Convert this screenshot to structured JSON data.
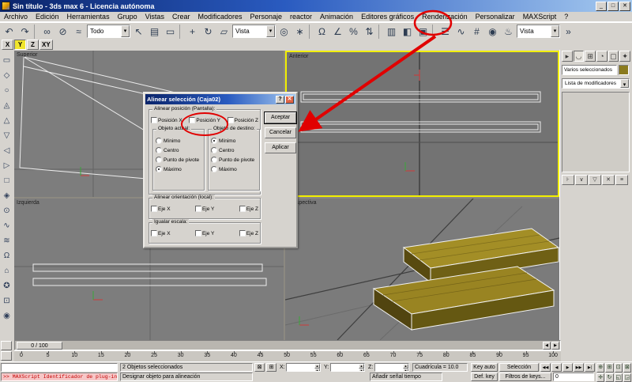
{
  "window": {
    "title": "Sin título - 3ds max 6 - Licencia autónoma"
  },
  "window_buttons": {
    "minimize": "_",
    "maximize": "□",
    "close": "✕"
  },
  "icons": {
    "dropdown_arrow": "▾",
    "spinner_up": "▴",
    "spinner_down": "▾",
    "lock": "⊠",
    "absolute": "⊞"
  },
  "menu": {
    "items": [
      "Archivo",
      "Edición",
      "Herramientas",
      "Grupo",
      "Vistas",
      "Crear",
      "Modificadores",
      "Personaje",
      "reactor",
      "Animación",
      "Editores gráficos",
      "Renderización",
      "Personalizar",
      "MAXScript",
      "?"
    ]
  },
  "toolbar": {
    "filter_value": "Todo",
    "coord_value": "Vista",
    "render_value": "Vista",
    "icons": {
      "undo": "↶",
      "redo": "↷",
      "link": "∞",
      "unlink": "⊘",
      "bind": "≈",
      "select": "↖",
      "select_by_name": "▤",
      "region": "▭",
      "move": "+",
      "rotate": "↻",
      "scale": "▱",
      "pivot": "◎",
      "manipulate": "∗",
      "snap": "Ω",
      "angle_snap": "∠",
      "percent_snap": "%",
      "spinner_snap": "⇅",
      "named_sel": "▥",
      "mirror": "◧",
      "align": "▣",
      "layers": "☰",
      "curve_editor": "∿",
      "schematic": "#",
      "material": "◉",
      "render": "♨",
      "quick_render": "»"
    }
  },
  "axis_toolbar": {
    "items": [
      {
        "label": "X",
        "active": false
      },
      {
        "label": "Y",
        "active": true
      },
      {
        "label": "Z",
        "active": false
      },
      {
        "label": "XY",
        "active": false
      }
    ]
  },
  "left_toolbar": {
    "icons": [
      {
        "n": "left-toolbar-icon",
        "g": "▭"
      },
      {
        "n": "left-toolbar-icon",
        "g": "◇"
      },
      {
        "n": "left-toolbar-icon",
        "g": "○"
      },
      {
        "n": "left-toolbar-icon",
        "g": "◬"
      },
      {
        "n": "left-toolbar-icon",
        "g": "△"
      },
      {
        "n": "left-toolbar-icon",
        "g": "▽"
      },
      {
        "n": "left-toolbar-icon",
        "g": "◁"
      },
      {
        "n": "left-toolbar-icon",
        "g": "▷"
      },
      {
        "n": "left-toolbar-icon",
        "g": "□"
      },
      {
        "n": "left-toolbar-icon",
        "g": "◈"
      },
      {
        "n": "left-toolbar-icon",
        "g": "⊙"
      },
      {
        "n": "left-toolbar-icon",
        "g": "∿"
      },
      {
        "n": "left-toolbar-icon",
        "g": "≋"
      },
      {
        "n": "left-toolbar-icon",
        "g": "Ω"
      },
      {
        "n": "left-toolbar-icon",
        "g": "⌂"
      },
      {
        "n": "left-toolbar-icon",
        "g": "✪"
      },
      {
        "n": "left-toolbar-icon",
        "g": "⊡"
      },
      {
        "n": "left-toolbar-icon",
        "g": "◉"
      }
    ]
  },
  "viewports": {
    "top_left_label": "Superior",
    "top_right_label": "Anterior",
    "bottom_left_label": "Izquierda",
    "bottom_right_label": "Perspectiva"
  },
  "dialog": {
    "title": "Alinear selección (Caja02)",
    "help_button": "?",
    "close_button": "✕",
    "position_group": "Alinear posición (Pantalla):",
    "position_checks": [
      "Posición X",
      "Posición Y",
      "Posición Z"
    ],
    "current_group": "Objeto actual:",
    "target_group": "Objeto de destino:",
    "current_options": [
      {
        "label": "Mínimo",
        "checked": false
      },
      {
        "label": "Centro",
        "checked": false
      },
      {
        "label": "Punto de pivote",
        "checked": false
      },
      {
        "label": "Máximo",
        "checked": true
      }
    ],
    "target_options": [
      {
        "label": "Mínimo",
        "checked": true
      },
      {
        "label": "Centro",
        "checked": false
      },
      {
        "label": "Punto de pivote",
        "checked": false
      },
      {
        "label": "Máximo",
        "checked": false
      }
    ],
    "orientation_group": "Alinear orientación (local):",
    "scale_group": "Igualar escala:",
    "axis_checks": [
      "Eje X",
      "Eje Y",
      "Eje Z"
    ],
    "buttons": {
      "ok": "Aceptar",
      "cancel": "Cancelar",
      "apply": "Aplicar"
    }
  },
  "command_panel": {
    "tabs": [
      {
        "n": "tab-create",
        "g": "▸",
        "active": false
      },
      {
        "n": "tab-modify",
        "g": "◡",
        "active": true
      },
      {
        "n": "tab-hierarchy",
        "g": "⊞",
        "active": false
      },
      {
        "n": "tab-motion",
        "g": "◔",
        "active": false
      },
      {
        "n": "tab-display",
        "g": "▢",
        "active": false
      },
      {
        "n": "tab-utilities",
        "g": "✦",
        "active": false
      }
    ],
    "name_field": "Varios seleccionados",
    "modifier_list": "Lista de modificadores",
    "object_color": "#8a7a1e",
    "stack_buttons": [
      {
        "n": "pin-stack-icon",
        "g": "⊦"
      },
      {
        "n": "show-end-result-icon",
        "g": "∨"
      },
      {
        "n": "make-unique-icon",
        "g": "▽"
      },
      {
        "n": "remove-modifier-icon",
        "g": "✕"
      },
      {
        "n": "configure-stack-icon",
        "g": "≡"
      }
    ]
  },
  "timeline": {
    "slider": "0 / 100",
    "left_arrow": "◀",
    "right_arrow": "▶",
    "ticks": [
      0,
      5,
      10,
      15,
      20,
      25,
      30,
      35,
      40,
      45,
      50,
      55,
      60,
      65,
      70,
      75,
      80,
      85,
      90,
      95,
      100
    ]
  },
  "status": {
    "selection": "2 Objetos seleccionados",
    "x_label": "X:",
    "y_label": "Y:",
    "z_label": "Z:",
    "x_value": "",
    "y_value": "",
    "z_value": "",
    "grid": "Cuadrícula = 10.0",
    "auto_key": "Key auto",
    "set_key": "Def. key",
    "selection_set": "Selección",
    "key_filters": "Filtros de keys...",
    "add_time_tag": "Añadir señal tiempo",
    "prompt": "Designar objeto para alineación",
    "maxscript": ">> MAXScript Identificador de plug-in guid",
    "frame_field": "0",
    "playback": [
      {
        "n": "go-start-button",
        "g": "◀◀"
      },
      {
        "n": "prev-frame-button",
        "g": "◀"
      },
      {
        "n": "play-button",
        "g": "▶"
      },
      {
        "n": "next-frame-button",
        "g": "▶▶"
      },
      {
        "n": "go-end-button",
        "g": "▶|"
      }
    ],
    "nav": [
      {
        "n": "zoom-icon",
        "g": "⊕"
      },
      {
        "n": "zoom-all-icon",
        "g": "⊞"
      },
      {
        "n": "zoom-extents-icon",
        "g": "⊡"
      },
      {
        "n": "zoom-extents-all-icon",
        "g": "⊠"
      },
      {
        "n": "pan-icon",
        "g": "✛"
      },
      {
        "n": "arc-rotate-icon",
        "g": "↻"
      },
      {
        "n": "region-zoom-icon",
        "g": "◱"
      },
      {
        "n": "min-max-toggle-icon",
        "g": "◲"
      }
    ]
  },
  "colors": {
    "annotation_red": "#e10000",
    "active_viewport_border": "#f2ef00",
    "box_olive": "#9c8a25",
    "chrome": "#d6d3ce",
    "title_gradient_start": "#0a246a",
    "title_gradient_end": "#a6caf0"
  }
}
